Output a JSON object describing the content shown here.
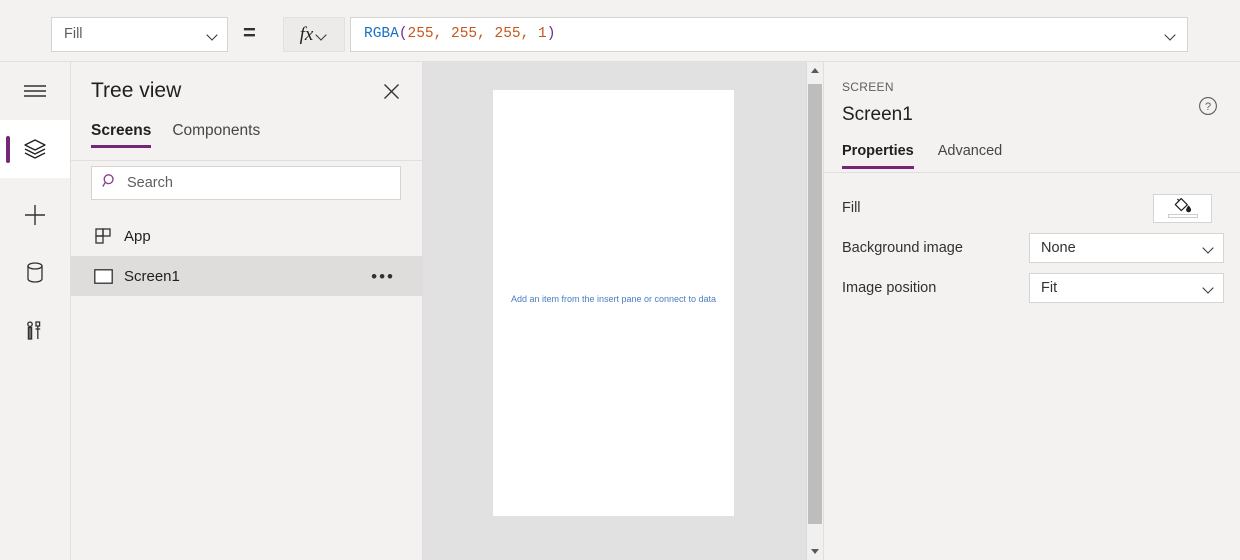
{
  "formula_bar": {
    "property_select": {
      "value": "Fill",
      "icon": "chevron-down-icon"
    },
    "equals": "=",
    "fx_label": "fx",
    "formula": {
      "function_name": "RGBA",
      "open_paren": "(",
      "args": "255, 255, 255, 1",
      "close_paren": ")",
      "full_text": "RGBA(255, 255, 255, 1)"
    },
    "expand_icon": "chevron-down-icon"
  },
  "rail": {
    "items": [
      {
        "name": "hamburger-menu",
        "icon": "hamburger-icon",
        "selected": false
      },
      {
        "name": "tree-view",
        "icon": "layers-icon",
        "selected": true
      },
      {
        "name": "insert",
        "icon": "plus-icon",
        "selected": false
      },
      {
        "name": "data",
        "icon": "database-icon",
        "selected": false
      },
      {
        "name": "tools",
        "icon": "tools-icon",
        "selected": false
      }
    ]
  },
  "treeview": {
    "title": "Tree view",
    "close_icon": "close-icon",
    "tabs": [
      {
        "label": "Screens",
        "active": true
      },
      {
        "label": "Components",
        "active": false
      }
    ],
    "search": {
      "placeholder": "Search",
      "value": "",
      "icon": "search-icon"
    },
    "items": [
      {
        "label": "App",
        "icon": "app-grid-icon",
        "selected": false,
        "has_menu": false
      },
      {
        "label": "Screen1",
        "icon": "screen-rect-icon",
        "selected": true,
        "has_menu": true,
        "menu_glyph": "•••"
      }
    ]
  },
  "canvas": {
    "placeholder_text": "Add an item from the insert pane or connect to data",
    "placeholder_color": "#4a7ec4",
    "background_color": "#e1e1e1",
    "screen_fill": "#ffffff",
    "scrollbar": {
      "up_icon": "scroll-up-arrow-icon",
      "down_icon": "scroll-down-arrow-icon"
    }
  },
  "properties_panel": {
    "kicker": "SCREEN",
    "title": "Screen1",
    "help_icon": "help-circle-icon",
    "tabs": [
      {
        "label": "Properties",
        "active": true
      },
      {
        "label": "Advanced",
        "active": false
      }
    ],
    "rows": [
      {
        "label": "Fill",
        "control": "color",
        "value": "#ffffff",
        "icon": "paint-bucket-icon"
      },
      {
        "label": "Background image",
        "control": "dropdown",
        "value": "None",
        "icon": "chevron-down-icon"
      },
      {
        "label": "Image position",
        "control": "dropdown",
        "value": "Fit",
        "icon": "chevron-down-icon"
      }
    ]
  },
  "theme": {
    "accent": "#742774",
    "panel_bg": "#f3f2f1",
    "border": "#e1dfdd",
    "selected_row": "#dedddc"
  }
}
